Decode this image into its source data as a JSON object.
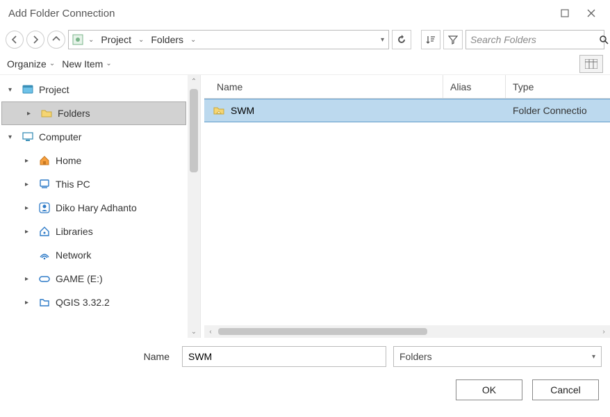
{
  "title": "Add Folder Connection",
  "breadcrumb": {
    "items": [
      "Project",
      "Folders"
    ]
  },
  "search": {
    "placeholder": "Search Folders"
  },
  "organize": {
    "label": "Organize",
    "newItem": "New Item"
  },
  "tree": {
    "items": [
      {
        "label": "Project",
        "arrow": "▾",
        "depth": 0,
        "iconKey": "project"
      },
      {
        "label": "Folders",
        "arrow": "▸",
        "depth": 1,
        "selected": true,
        "iconKey": "folder"
      },
      {
        "label": "Computer",
        "arrow": "▾",
        "depth": 0,
        "iconKey": "computer"
      },
      {
        "label": "Home",
        "arrow": "▸",
        "depth": 1,
        "iconKey": "home"
      },
      {
        "label": "This PC",
        "arrow": "▸",
        "depth": 1,
        "iconKey": "pc"
      },
      {
        "label": "Diko Hary Adhanto",
        "arrow": "▸",
        "depth": 1,
        "iconKey": "user"
      },
      {
        "label": "Libraries",
        "arrow": "▸",
        "depth": 1,
        "iconKey": "lib"
      },
      {
        "label": "Network",
        "arrow": "",
        "depth": 1,
        "iconKey": "net"
      },
      {
        "label": "GAME (E:)",
        "arrow": "▸",
        "depth": 1,
        "iconKey": "drive"
      },
      {
        "label": "QGIS 3.32.2",
        "arrow": "▸",
        "depth": 1,
        "iconKey": "generic"
      }
    ]
  },
  "list": {
    "columns": {
      "name": "Name",
      "alias": "Alias",
      "type": "Type"
    },
    "rows": [
      {
        "name": "SWM",
        "alias": "",
        "type": "Folder Connectio",
        "selected": true
      }
    ]
  },
  "form": {
    "nameLabel": "Name",
    "nameValue": "SWM",
    "typeLabel": "Folders"
  },
  "buttons": {
    "ok": "OK",
    "cancel": "Cancel"
  }
}
